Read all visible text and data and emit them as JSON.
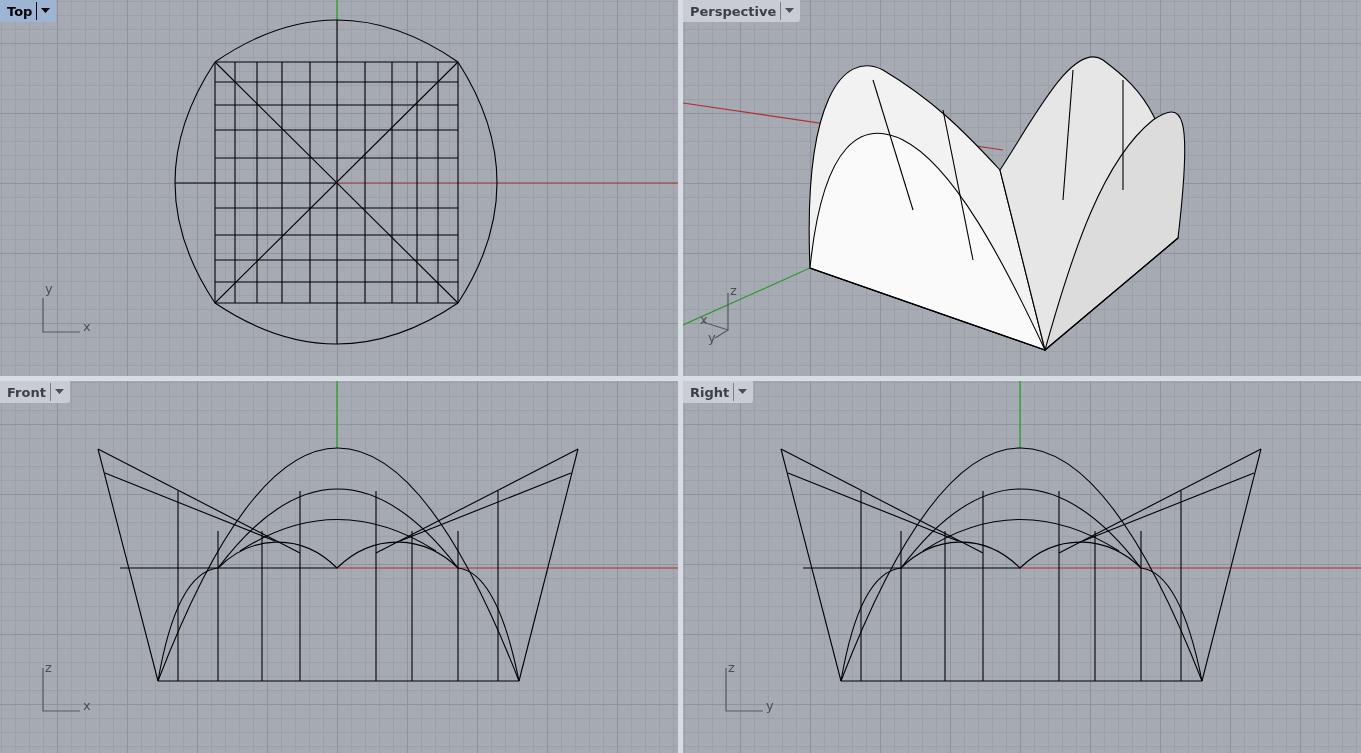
{
  "viewports": [
    {
      "title": "Top",
      "selected": true,
      "kind": "top",
      "axis_labels": [
        "y",
        "x"
      ]
    },
    {
      "title": "Perspective",
      "selected": false,
      "kind": "perspective",
      "axis_labels": [
        "z",
        "x",
        "y"
      ]
    },
    {
      "title": "Front",
      "selected": false,
      "kind": "front",
      "axis_labels": [
        "z",
        "x"
      ]
    },
    {
      "title": "Right",
      "selected": false,
      "kind": "right",
      "axis_labels": [
        "z",
        "y"
      ]
    }
  ]
}
